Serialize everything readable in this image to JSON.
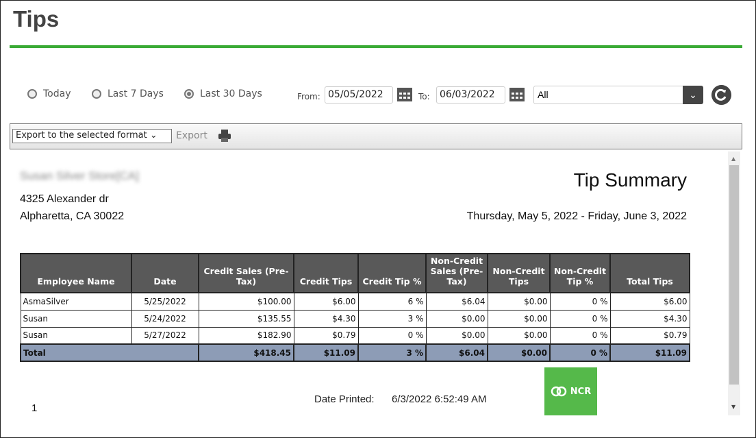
{
  "header": {
    "title": "Tips",
    "accent": "#3aaa35"
  },
  "filters": {
    "radios": [
      {
        "label": "Today",
        "selected": false
      },
      {
        "label": "Last 7 Days",
        "selected": false
      },
      {
        "label": "Last 30 Days",
        "selected": true
      }
    ],
    "from_label": "From:",
    "from_value": "05/05/2022",
    "to_label": "To:",
    "to_value": "06/03/2022",
    "employee_select": "All"
  },
  "toolbar": {
    "export_format": "Export to the selected format",
    "export_label": "Export"
  },
  "report": {
    "store_name": "Susan Silver Store[CA]",
    "address1": "4325 Alexander dr",
    "address2": "Alpharetta, CA 30022",
    "title": "Tip Summary",
    "date_range": "Thursday, May 5, 2022 - Friday, June 3, 2022",
    "columns": [
      "Employee Name",
      "Date",
      "Credit Sales (Pre-Tax)",
      "Credit Tips",
      "Credit Tip %",
      "Non-Credit Sales (Pre-Tax)",
      "Non-Credit Tips",
      "Non-Credit Tip %",
      "Total Tips"
    ],
    "rows": [
      [
        "AsmaSilver",
        "5/25/2022",
        "$100.00",
        "$6.00",
        "6 %",
        "$6.04",
        "$0.00",
        "0 %",
        "$6.00"
      ],
      [
        "Susan",
        "5/24/2022",
        "$135.55",
        "$4.30",
        "3 %",
        "$0.00",
        "$0.00",
        "0 %",
        "$4.30"
      ],
      [
        "Susan",
        "5/27/2022",
        "$182.90",
        "$0.79",
        "0 %",
        "$0.00",
        "$0.00",
        "0 %",
        "$0.79"
      ]
    ],
    "total": [
      "Total",
      "",
      "$418.45",
      "$11.09",
      "3 %",
      "$6.04",
      "$0.00",
      "0 %",
      "$11.09"
    ],
    "page_number": "1",
    "date_printed_label": "Date Printed:",
    "date_printed_value": "6/3/2022 6:52:49 AM",
    "logo": "NCR"
  }
}
